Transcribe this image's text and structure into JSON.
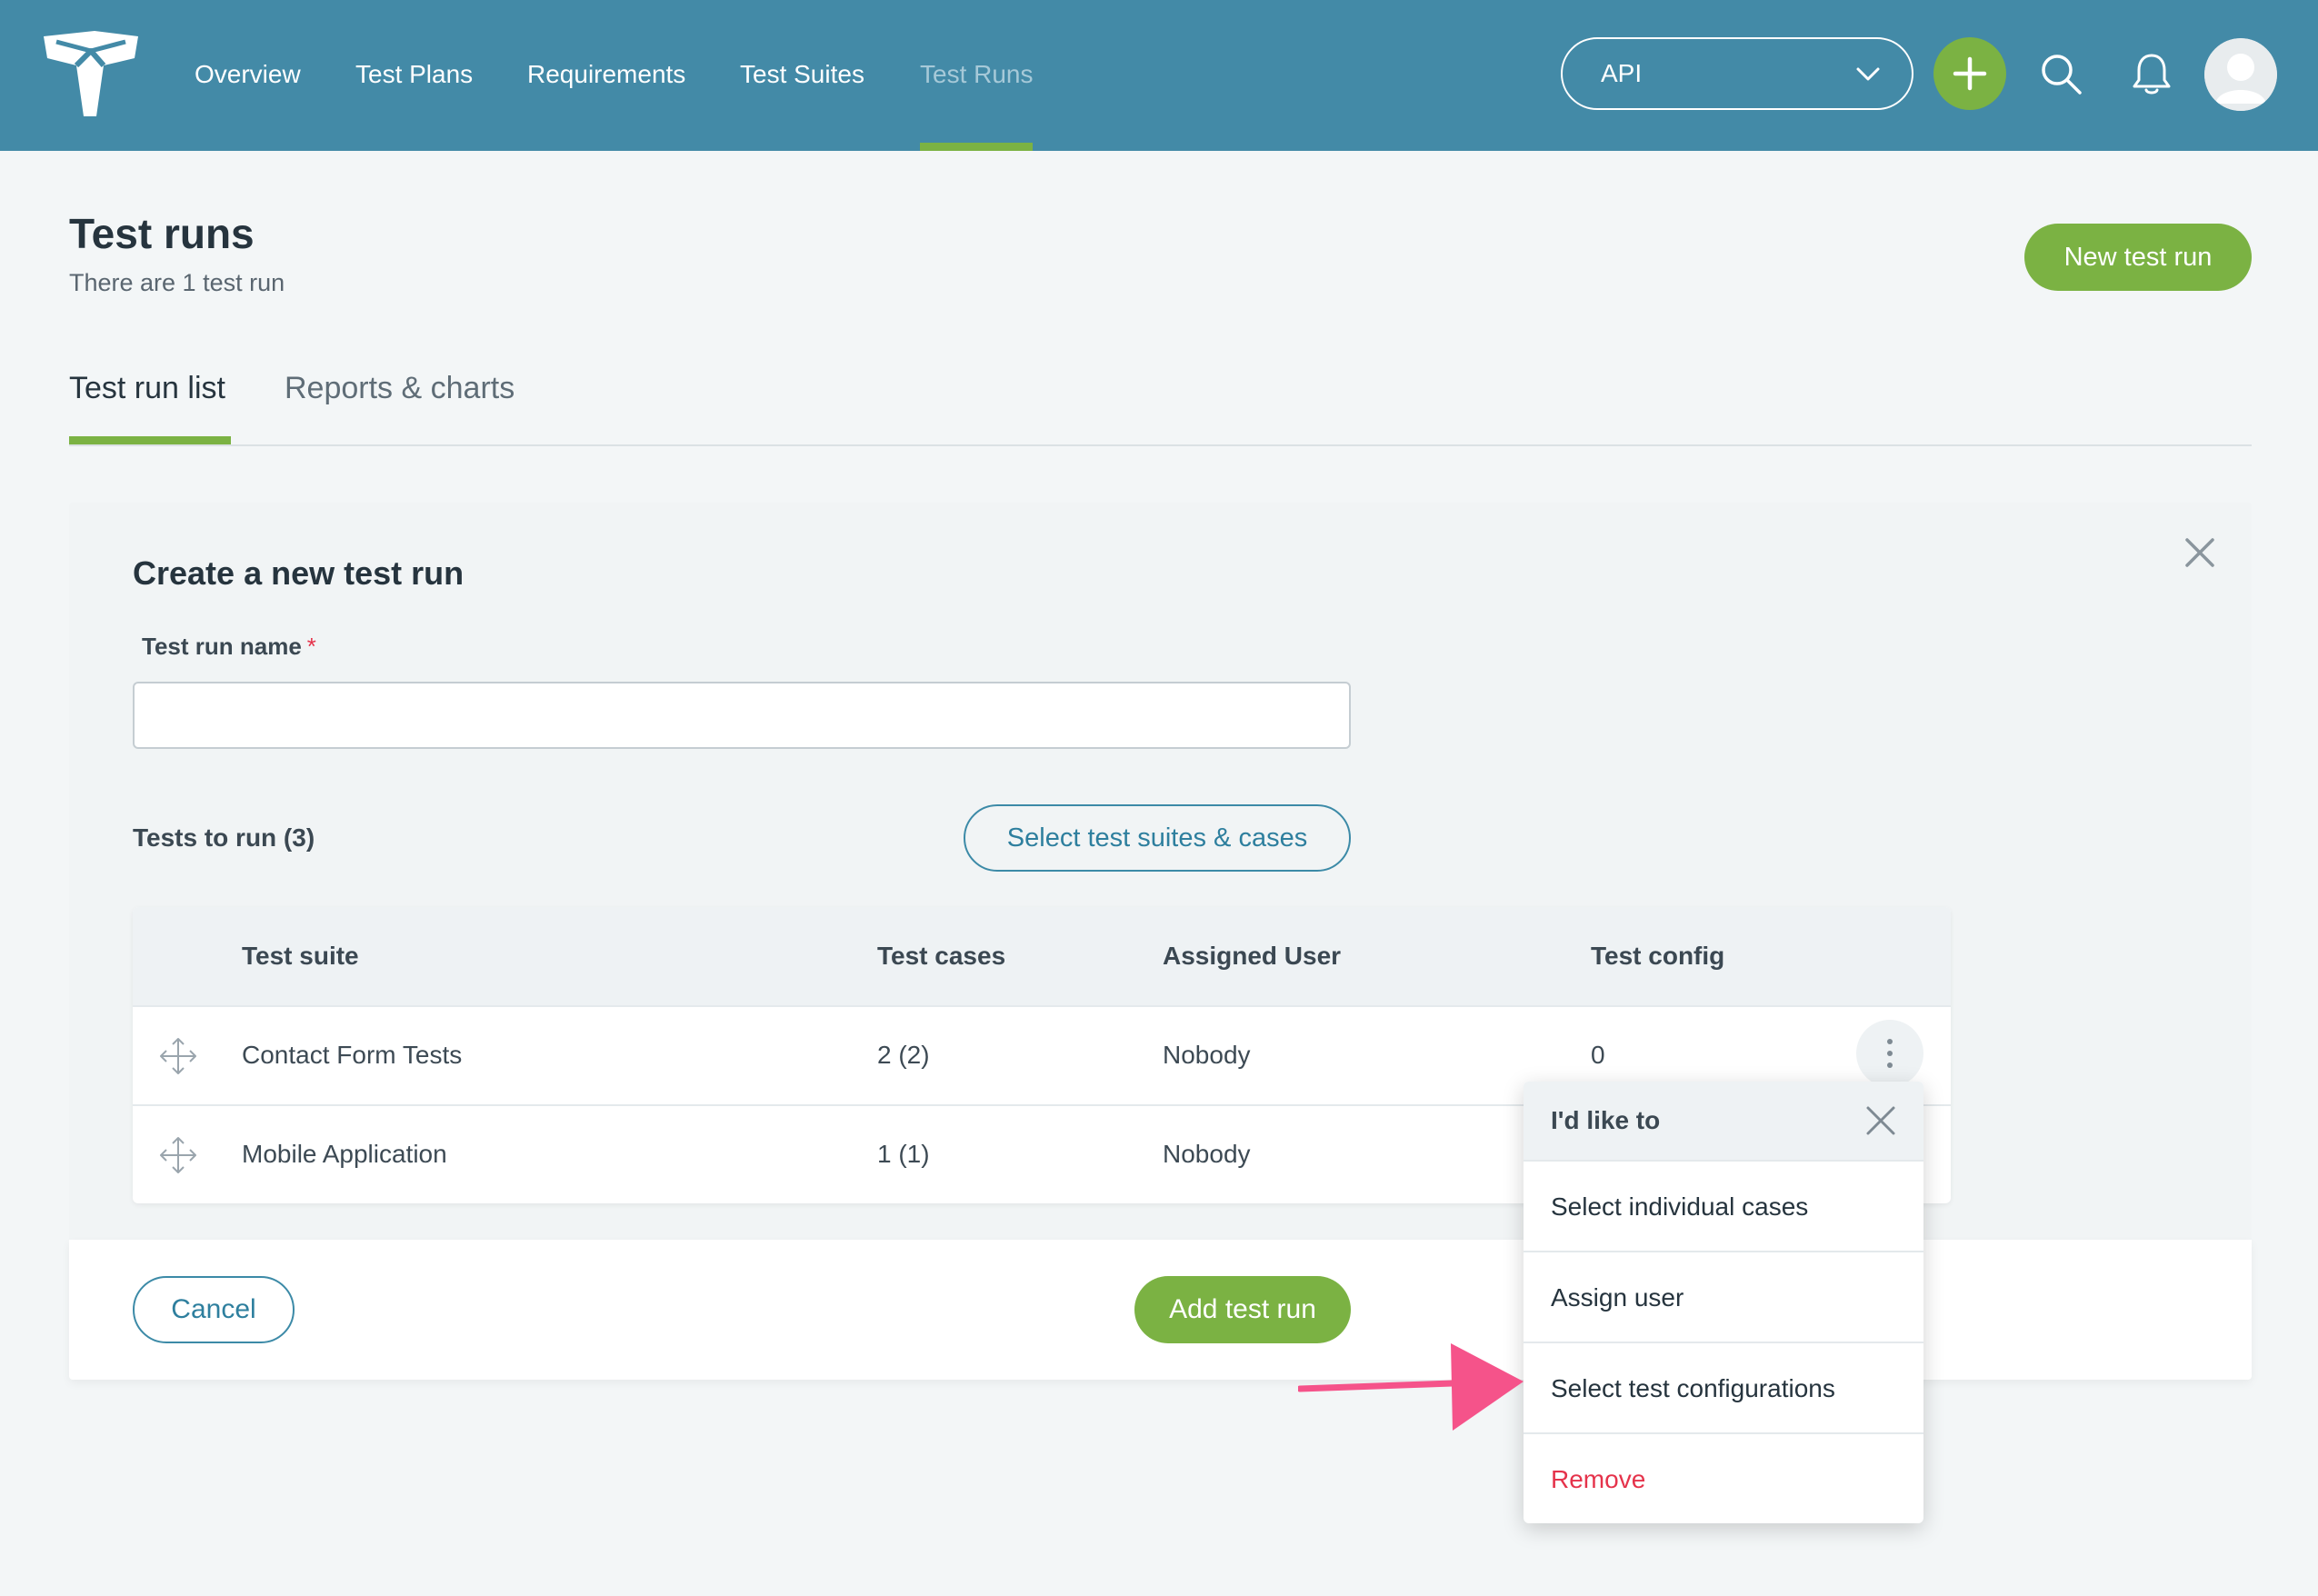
{
  "nav": {
    "items": [
      {
        "label": "Overview",
        "active": false
      },
      {
        "label": "Test Plans",
        "active": false
      },
      {
        "label": "Requirements",
        "active": false
      },
      {
        "label": "Test Suites",
        "active": false
      },
      {
        "label": "Test Runs",
        "active": true
      }
    ],
    "project": "API"
  },
  "header": {
    "title": "Test runs",
    "subtitle": "There are 1 test run",
    "new_button": "New test run"
  },
  "tabs": [
    {
      "label": "Test run list",
      "active": true
    },
    {
      "label": "Reports & charts",
      "active": false
    }
  ],
  "create_form": {
    "title": "Create a new test run",
    "name_label": "Test run name",
    "required_mark": "*",
    "name_value": "",
    "tests_label": "Tests to run (3)",
    "select_button": "Select test suites & cases",
    "table": {
      "headers": [
        "Test suite",
        "Test cases",
        "Assigned User",
        "Test config"
      ],
      "rows": [
        {
          "suite": "Contact Form Tests",
          "cases": "2  (2)",
          "user": "Nobody",
          "config": "0"
        },
        {
          "suite": "Mobile Application",
          "cases": "1  (1)",
          "user": "Nobody",
          "config": ""
        }
      ]
    },
    "cancel": "Cancel",
    "submit": "Add test run"
  },
  "menu": {
    "title": "I'd like to",
    "items": [
      {
        "label": "Select individual cases",
        "danger": false
      },
      {
        "label": "Assign user",
        "danger": false
      },
      {
        "label": "Select test configurations",
        "danger": false
      },
      {
        "label": "Remove",
        "danger": true
      }
    ]
  },
  "colors": {
    "topbar": "#438aa7",
    "accent_green": "#7bb243",
    "link_teal": "#2e7f9e",
    "danger": "#e5334b",
    "annotation_arrow": "#f5538a"
  }
}
